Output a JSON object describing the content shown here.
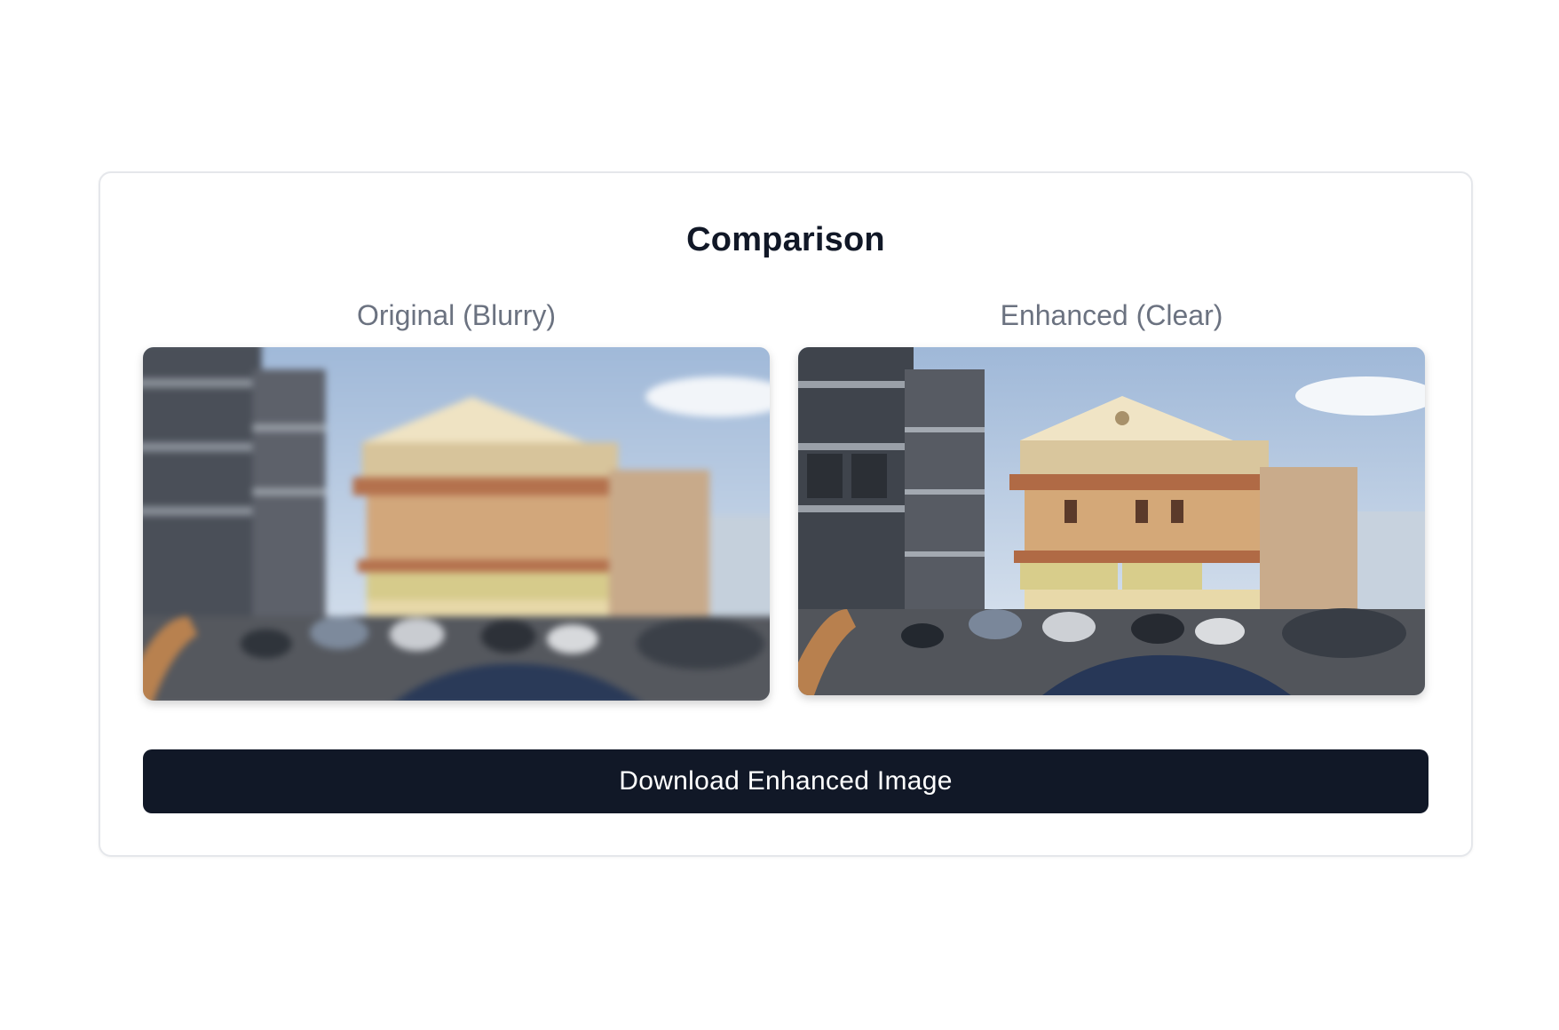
{
  "comparison": {
    "title": "Comparison",
    "original_label": "Original (Blurry)",
    "enhanced_label": "Enhanced (Clear)",
    "download_label": "Download Enhanced Image"
  },
  "colors": {
    "primary_button": "#111827",
    "muted_text": "#6b7280",
    "card_border": "#e5e7eb"
  }
}
